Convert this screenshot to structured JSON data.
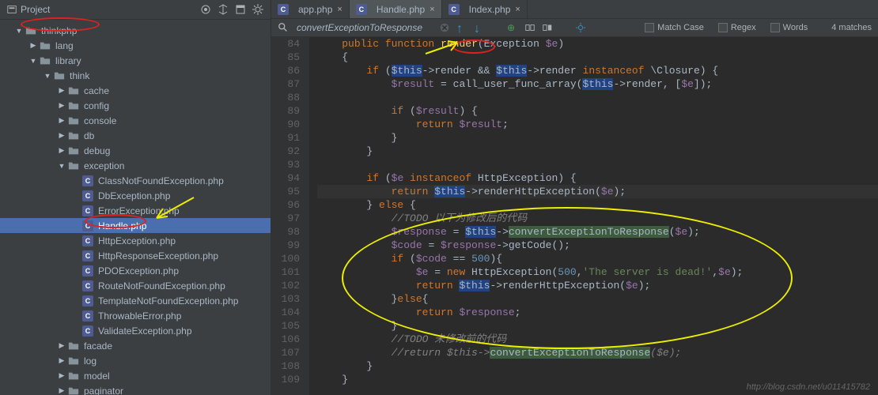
{
  "project": {
    "title": "Project",
    "tree": [
      {
        "indent": 1,
        "type": "folder",
        "open": true,
        "name": "thinkphp"
      },
      {
        "indent": 2,
        "type": "folder",
        "open": false,
        "name": "lang"
      },
      {
        "indent": 2,
        "type": "folder",
        "open": true,
        "name": "library"
      },
      {
        "indent": 3,
        "type": "folder",
        "open": true,
        "name": "think"
      },
      {
        "indent": 4,
        "type": "folder",
        "open": false,
        "name": "cache"
      },
      {
        "indent": 4,
        "type": "folder",
        "open": false,
        "name": "config"
      },
      {
        "indent": 4,
        "type": "folder",
        "open": false,
        "name": "console"
      },
      {
        "indent": 4,
        "type": "folder",
        "open": false,
        "name": "db"
      },
      {
        "indent": 4,
        "type": "folder",
        "open": false,
        "name": "debug"
      },
      {
        "indent": 4,
        "type": "folder",
        "open": true,
        "name": "exception"
      },
      {
        "indent": 5,
        "type": "php",
        "name": "ClassNotFoundException.php"
      },
      {
        "indent": 5,
        "type": "php",
        "name": "DbException.php"
      },
      {
        "indent": 5,
        "type": "php",
        "name": "ErrorException.php"
      },
      {
        "indent": 5,
        "type": "php",
        "name": "Handle.php",
        "selected": true
      },
      {
        "indent": 5,
        "type": "php",
        "name": "HttpException.php"
      },
      {
        "indent": 5,
        "type": "php",
        "name": "HttpResponseException.php"
      },
      {
        "indent": 5,
        "type": "php",
        "name": "PDOException.php"
      },
      {
        "indent": 5,
        "type": "php",
        "name": "RouteNotFoundException.php"
      },
      {
        "indent": 5,
        "type": "php",
        "name": "TemplateNotFoundException.php"
      },
      {
        "indent": 5,
        "type": "php",
        "name": "ThrowableError.php"
      },
      {
        "indent": 5,
        "type": "php",
        "name": "ValidateException.php"
      },
      {
        "indent": 4,
        "type": "folder",
        "open": false,
        "name": "facade"
      },
      {
        "indent": 4,
        "type": "folder",
        "open": false,
        "name": "log"
      },
      {
        "indent": 4,
        "type": "folder",
        "open": false,
        "name": "model"
      },
      {
        "indent": 4,
        "type": "folder",
        "open": false,
        "name": "paginator"
      }
    ]
  },
  "tabs": [
    {
      "label": "app.php",
      "active": false
    },
    {
      "label": "Handle.php",
      "active": true
    },
    {
      "label": "Index.php",
      "active": false
    }
  ],
  "search": {
    "query": "convertExceptionToResponse",
    "matchCase": "Match Case",
    "regex": "Regex",
    "words": "Words",
    "matches": "4 matches"
  },
  "code": {
    "startLine": 84,
    "lines": [
      {
        "n": 84,
        "html": "    <span class='kw'>public function</span> <span class='fn'>render</span>(Exception <span class='var'>$e</span>)"
      },
      {
        "n": 85,
        "html": "    {"
      },
      {
        "n": 86,
        "html": "        <span class='kw'>if</span> (<span class='hl'>$this</span>->render && <span class='hl'>$this</span>->render <span class='kw'>instanceof</span> \\Closure) {"
      },
      {
        "n": 87,
        "html": "            <span class='var'>$result</span> = call_user_func_array(<span class='hl'>$this</span>->render, [<span class='var'>$e</span>]);"
      },
      {
        "n": 88,
        "html": ""
      },
      {
        "n": 89,
        "html": "            <span class='kw'>if</span> (<span class='var'>$result</span>) {"
      },
      {
        "n": 90,
        "html": "                <span class='kw'>return</span> <span class='var'>$result</span>;"
      },
      {
        "n": 91,
        "html": "            }"
      },
      {
        "n": 92,
        "html": "        }"
      },
      {
        "n": 93,
        "html": ""
      },
      {
        "n": 94,
        "html": "        <span class='kw'>if</span> (<span class='var'>$e</span> <span class='kw'>instanceof</span> HttpException) {"
      },
      {
        "n": 95,
        "html": "            <span class='kw'>return</span> <span class='hl'>$this</span>->renderHttpException(<span class='var'>$e</span>);",
        "cur": true
      },
      {
        "n": 96,
        "html": "        } <span class='kw'>else</span> {"
      },
      {
        "n": 97,
        "html": "            <span class='cm'>//TODO 以下为修改后的代码</span>"
      },
      {
        "n": 98,
        "html": "            <span class='var'>$response</span> = <span class='hl'>$this</span>-><span class='hlg'>convertExceptionToResponse</span>(<span class='var'>$e</span>);"
      },
      {
        "n": 99,
        "html": "            <span class='var'>$code</span> = <span class='var'>$response</span>->getCode();"
      },
      {
        "n": 100,
        "html": "            <span class='kw'>if</span> (<span class='var'>$code</span> == <span class='num'>500</span>){"
      },
      {
        "n": 101,
        "html": "                <span class='var'>$e</span> = <span class='kw'>new</span> HttpException(<span class='num'>500</span>,<span class='str'>'The server is dead!'</span>,<span class='var'>$e</span>);"
      },
      {
        "n": 102,
        "html": "                <span class='kw'>return</span> <span class='hl'>$this</span>->renderHttpException(<span class='var'>$e</span>);"
      },
      {
        "n": 103,
        "html": "            }<span class='kw'>else</span>{"
      },
      {
        "n": 104,
        "html": "                <span class='kw'>return</span> <span class='var'>$response</span>;"
      },
      {
        "n": 105,
        "html": "            }"
      },
      {
        "n": 106,
        "html": "            <span class='cm'>//TODO 未修改前的代码</span>"
      },
      {
        "n": 107,
        "html": "            <span class='cm'>//return $this-></span><span class='hlg'>convertExceptionToResponse</span><span class='cm'>($e);</span>"
      },
      {
        "n": 108,
        "html": "        }"
      },
      {
        "n": 109,
        "html": "    }"
      }
    ]
  },
  "watermark": "http://blog.csdn.net/u011415782"
}
